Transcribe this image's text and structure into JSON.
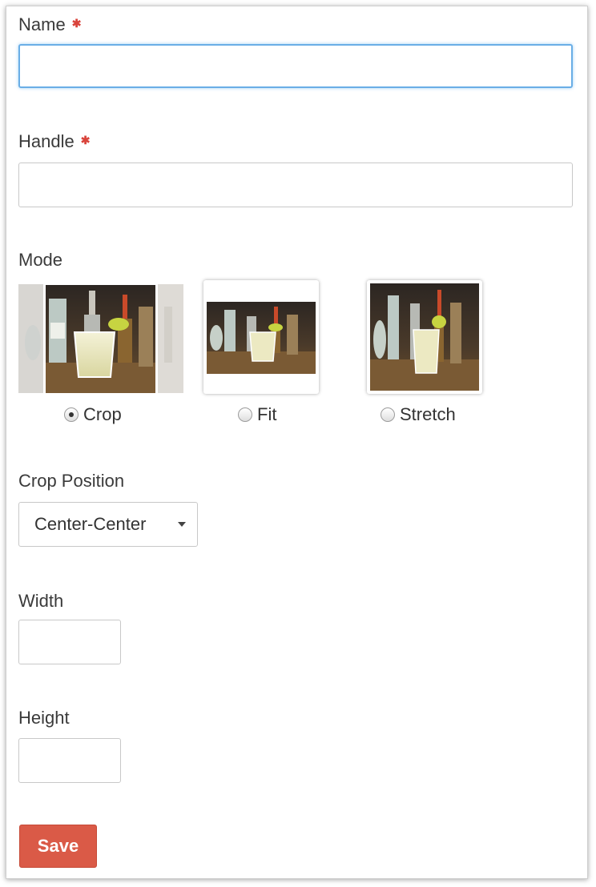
{
  "form": {
    "name": {
      "label": "Name",
      "required_mark": "✱",
      "value": ""
    },
    "handle": {
      "label": "Handle",
      "required_mark": "✱",
      "value": ""
    },
    "mode": {
      "label": "Mode",
      "options": [
        {
          "label": "Crop",
          "selected": true
        },
        {
          "label": "Fit",
          "selected": false
        },
        {
          "label": "Stretch",
          "selected": false
        }
      ]
    },
    "crop_position": {
      "label": "Crop Position",
      "selected": "Center-Center"
    },
    "width": {
      "label": "Width",
      "value": ""
    },
    "height": {
      "label": "Height",
      "value": ""
    },
    "save_label": "Save"
  },
  "colors": {
    "accent": "#da5a47",
    "required": "#d9443c",
    "focus": "#6aaee6"
  }
}
